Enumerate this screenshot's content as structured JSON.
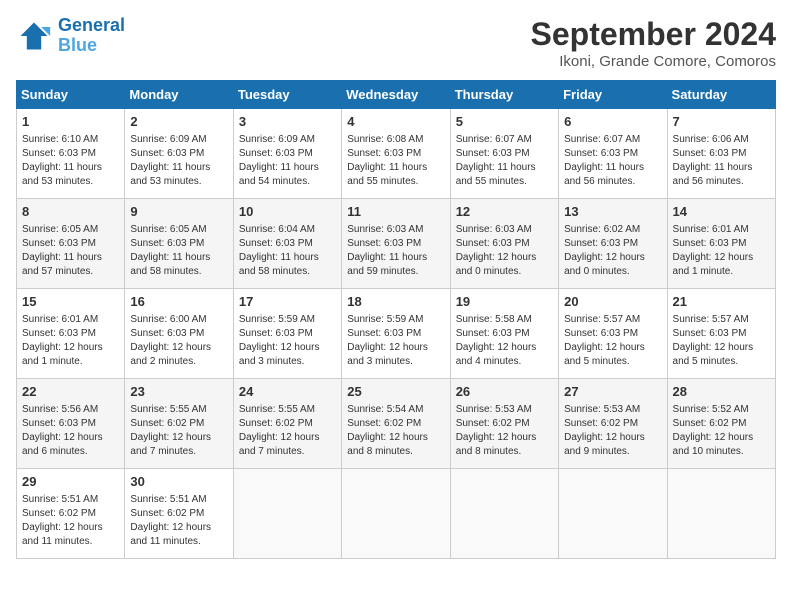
{
  "header": {
    "logo_line1": "General",
    "logo_line2": "Blue",
    "title": "September 2024",
    "subtitle": "Ikoni, Grande Comore, Comoros"
  },
  "weekdays": [
    "Sunday",
    "Monday",
    "Tuesday",
    "Wednesday",
    "Thursday",
    "Friday",
    "Saturday"
  ],
  "weeks": [
    [
      {
        "day": "1",
        "info": "Sunrise: 6:10 AM\nSunset: 6:03 PM\nDaylight: 11 hours\nand 53 minutes."
      },
      {
        "day": "2",
        "info": "Sunrise: 6:09 AM\nSunset: 6:03 PM\nDaylight: 11 hours\nand 53 minutes."
      },
      {
        "day": "3",
        "info": "Sunrise: 6:09 AM\nSunset: 6:03 PM\nDaylight: 11 hours\nand 54 minutes."
      },
      {
        "day": "4",
        "info": "Sunrise: 6:08 AM\nSunset: 6:03 PM\nDaylight: 11 hours\nand 55 minutes."
      },
      {
        "day": "5",
        "info": "Sunrise: 6:07 AM\nSunset: 6:03 PM\nDaylight: 11 hours\nand 55 minutes."
      },
      {
        "day": "6",
        "info": "Sunrise: 6:07 AM\nSunset: 6:03 PM\nDaylight: 11 hours\nand 56 minutes."
      },
      {
        "day": "7",
        "info": "Sunrise: 6:06 AM\nSunset: 6:03 PM\nDaylight: 11 hours\nand 56 minutes."
      }
    ],
    [
      {
        "day": "8",
        "info": "Sunrise: 6:05 AM\nSunset: 6:03 PM\nDaylight: 11 hours\nand 57 minutes."
      },
      {
        "day": "9",
        "info": "Sunrise: 6:05 AM\nSunset: 6:03 PM\nDaylight: 11 hours\nand 58 minutes."
      },
      {
        "day": "10",
        "info": "Sunrise: 6:04 AM\nSunset: 6:03 PM\nDaylight: 11 hours\nand 58 minutes."
      },
      {
        "day": "11",
        "info": "Sunrise: 6:03 AM\nSunset: 6:03 PM\nDaylight: 11 hours\nand 59 minutes."
      },
      {
        "day": "12",
        "info": "Sunrise: 6:03 AM\nSunset: 6:03 PM\nDaylight: 12 hours\nand 0 minutes."
      },
      {
        "day": "13",
        "info": "Sunrise: 6:02 AM\nSunset: 6:03 PM\nDaylight: 12 hours\nand 0 minutes."
      },
      {
        "day": "14",
        "info": "Sunrise: 6:01 AM\nSunset: 6:03 PM\nDaylight: 12 hours\nand 1 minute."
      }
    ],
    [
      {
        "day": "15",
        "info": "Sunrise: 6:01 AM\nSunset: 6:03 PM\nDaylight: 12 hours\nand 1 minute."
      },
      {
        "day": "16",
        "info": "Sunrise: 6:00 AM\nSunset: 6:03 PM\nDaylight: 12 hours\nand 2 minutes."
      },
      {
        "day": "17",
        "info": "Sunrise: 5:59 AM\nSunset: 6:03 PM\nDaylight: 12 hours\nand 3 minutes."
      },
      {
        "day": "18",
        "info": "Sunrise: 5:59 AM\nSunset: 6:03 PM\nDaylight: 12 hours\nand 3 minutes."
      },
      {
        "day": "19",
        "info": "Sunrise: 5:58 AM\nSunset: 6:03 PM\nDaylight: 12 hours\nand 4 minutes."
      },
      {
        "day": "20",
        "info": "Sunrise: 5:57 AM\nSunset: 6:03 PM\nDaylight: 12 hours\nand 5 minutes."
      },
      {
        "day": "21",
        "info": "Sunrise: 5:57 AM\nSunset: 6:03 PM\nDaylight: 12 hours\nand 5 minutes."
      }
    ],
    [
      {
        "day": "22",
        "info": "Sunrise: 5:56 AM\nSunset: 6:03 PM\nDaylight: 12 hours\nand 6 minutes."
      },
      {
        "day": "23",
        "info": "Sunrise: 5:55 AM\nSunset: 6:02 PM\nDaylight: 12 hours\nand 7 minutes."
      },
      {
        "day": "24",
        "info": "Sunrise: 5:55 AM\nSunset: 6:02 PM\nDaylight: 12 hours\nand 7 minutes."
      },
      {
        "day": "25",
        "info": "Sunrise: 5:54 AM\nSunset: 6:02 PM\nDaylight: 12 hours\nand 8 minutes."
      },
      {
        "day": "26",
        "info": "Sunrise: 5:53 AM\nSunset: 6:02 PM\nDaylight: 12 hours\nand 8 minutes."
      },
      {
        "day": "27",
        "info": "Sunrise: 5:53 AM\nSunset: 6:02 PM\nDaylight: 12 hours\nand 9 minutes."
      },
      {
        "day": "28",
        "info": "Sunrise: 5:52 AM\nSunset: 6:02 PM\nDaylight: 12 hours\nand 10 minutes."
      }
    ],
    [
      {
        "day": "29",
        "info": "Sunrise: 5:51 AM\nSunset: 6:02 PM\nDaylight: 12 hours\nand 11 minutes."
      },
      {
        "day": "30",
        "info": "Sunrise: 5:51 AM\nSunset: 6:02 PM\nDaylight: 12 hours\nand 11 minutes."
      },
      {
        "day": "",
        "info": ""
      },
      {
        "day": "",
        "info": ""
      },
      {
        "day": "",
        "info": ""
      },
      {
        "day": "",
        "info": ""
      },
      {
        "day": "",
        "info": ""
      }
    ]
  ]
}
